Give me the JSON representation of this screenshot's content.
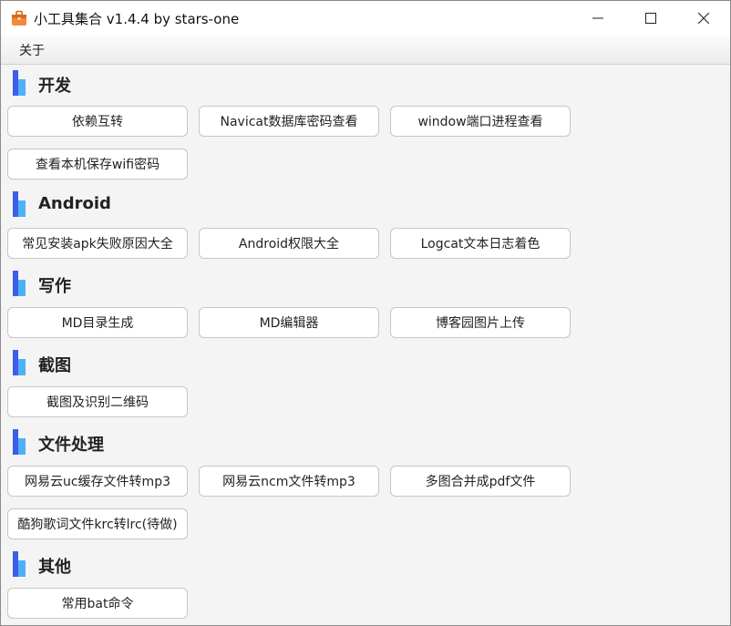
{
  "window": {
    "title": "小工具集合 v1.4.4 by stars-one",
    "icon": "toolbox-icon",
    "accent": "#3a6ff0"
  },
  "menu": {
    "items": [
      {
        "label": "关于"
      }
    ]
  },
  "sections": [
    {
      "label": "开发",
      "buttons": [
        {
          "label": "依赖互转"
        },
        {
          "label": "Navicat数据库密码查看"
        },
        {
          "label": "window端口进程查看"
        },
        {
          "label": "查看本机保存wifi密码"
        }
      ]
    },
    {
      "label": "Android",
      "buttons": [
        {
          "label": "常见安装apk失败原因大全"
        },
        {
          "label": "Android权限大全"
        },
        {
          "label": "Logcat文本日志着色"
        }
      ]
    },
    {
      "label": "写作",
      "buttons": [
        {
          "label": "MD目录生成"
        },
        {
          "label": "MD编辑器"
        },
        {
          "label": "博客园图片上传"
        }
      ]
    },
    {
      "label": "截图",
      "buttons": [
        {
          "label": "截图及识别二维码"
        }
      ]
    },
    {
      "label": "文件处理",
      "buttons": [
        {
          "label": "网易云uc缓存文件转mp3"
        },
        {
          "label": "网易云ncm文件转mp3"
        },
        {
          "label": "多图合并成pdf文件"
        },
        {
          "label": "酷狗歌词文件krc转lrc(待做)"
        }
      ]
    },
    {
      "label": "其他",
      "buttons": [
        {
          "label": "常用bat命令"
        }
      ]
    }
  ]
}
